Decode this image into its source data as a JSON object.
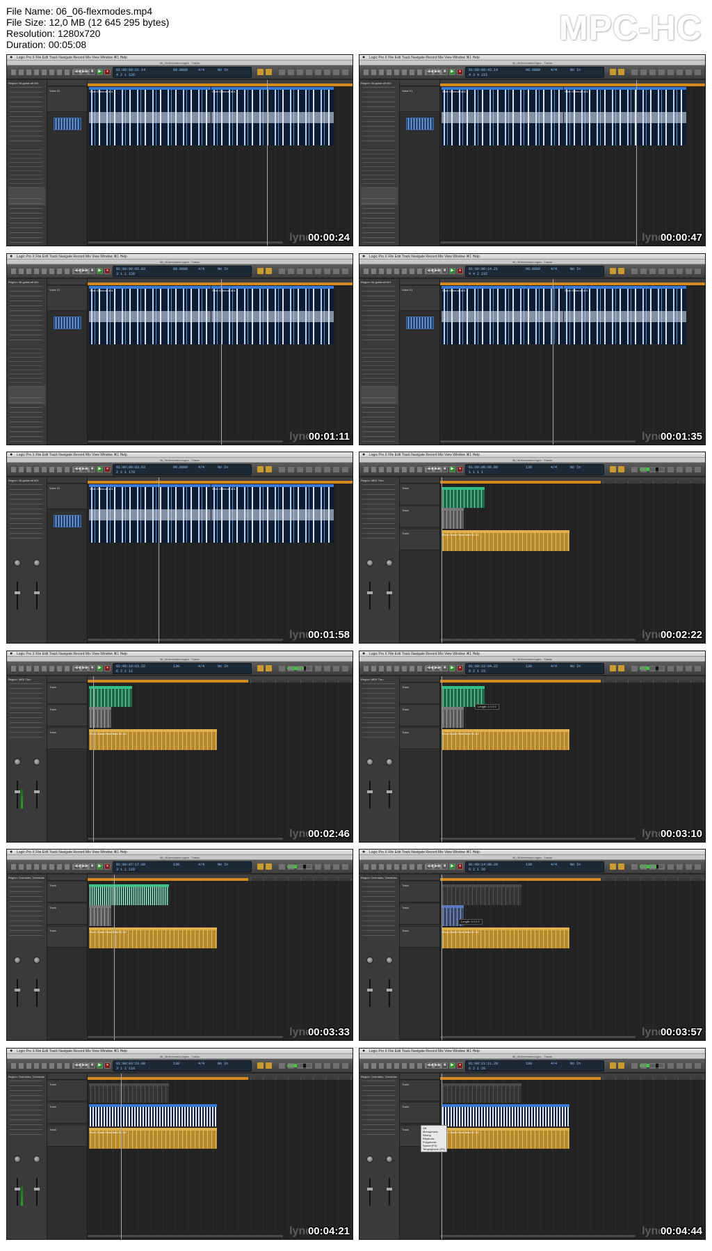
{
  "file_info": {
    "file_name": "File Name: 06_06-flexmodes.mp4",
    "file_size": "File Size: 12,0 MB (12 645 295 bytes)",
    "resolution": "Resolution: 1280x720",
    "duration": "Duration: 00:05:08"
  },
  "player_logo": "MPC-HC",
  "watermark": "lynd",
  "menu_items": "Logic Pro X   File   Edit   Track   Navigate   Record   Mix   View   Window   ⌘1   Help",
  "thumbnails": [
    {
      "timestamp": "00:00:24",
      "window_title": "06_06-flexmodes.logicx - Tracks",
      "lcd_top": "01:00:00:21.14",
      "lcd_bottom": "4  2  1  126",
      "tempo": "90.0000",
      "signature": "4/4",
      "key": "No In",
      "inspector_title": "Region: 06-guitar.aif #01",
      "track_name": "Voice 01",
      "region_label": "Slide Guitar.aif #01"
    },
    {
      "timestamp": "00:00:47",
      "window_title": "06_06-flexmodes.logicx - Tracks",
      "lcd_top": "01:00:00:42.14",
      "lcd_bottom": "4  3  4  215",
      "tempo": "90.0000",
      "signature": "4/4",
      "key": "No In",
      "inspector_title": "Region: 06-guitar.aif #01",
      "track_name": "Voice 01",
      "region_label": "Slide Guitar.aif #01"
    },
    {
      "timestamp": "00:01:11",
      "window_title": "06_06-flexmodes.logicx - Tracks",
      "lcd_top": "01:00:00:02.03",
      "lcd_bottom": "3  1  1  120",
      "tempo": "90.0000",
      "signature": "4/4",
      "key": "No In",
      "inspector_title": "Region: 06-guitar.aif #01",
      "track_name": "Voice 01",
      "region_label": "Slide Guitar.aif #01"
    },
    {
      "timestamp": "00:01:35",
      "window_title": "06_06-flexmodes.logicx - Tracks",
      "lcd_top": "01:00:00:14.21",
      "lcd_bottom": "4  4  2  215",
      "tempo": "90.0000",
      "signature": "4/4",
      "key": "No In",
      "inspector_title": "Region: 06-guitar.aif #01",
      "track_name": "Voice 01",
      "region_label": "Slide Guitar.aif #01"
    },
    {
      "timestamp": "00:01:58",
      "window_title": "06_06-flexmodes.logicx - Tracks",
      "lcd_top": "01:00:00:03.03",
      "lcd_bottom": "2  1  1  170",
      "tempo": "90.0000",
      "signature": "4/4",
      "key": "No In",
      "inspector_title": "Region: 06-guitar.aif #01",
      "track_name": "Voice 01",
      "region_label": "Slide Guitar.aif #01"
    },
    {
      "timestamp": "00:02:22",
      "window_title": "06_06-flexmodes.logicx - Tracks",
      "lcd_top": "01:00:00:00.00",
      "lcd_bottom": "1  1  1  1",
      "tempo": "130",
      "signature": "4/4",
      "key": "No In",
      "inspector_title": "Region: MIDI Thru",
      "track_name": "Track",
      "region_label": "Floor Guitar Rock Beat 02.1/2"
    },
    {
      "timestamp": "00:02:46",
      "window_title": "06_06-flexmodes.logicx - Tracks",
      "lcd_top": "01:00:10:03.22",
      "lcd_bottom": "6  2  1  11",
      "tempo": "130",
      "signature": "4/4",
      "key": "No In",
      "inspector_title": "Region: MIDI Thru",
      "track_name": "Track",
      "region_label": "Floor Guitar Rock Beat 02.1/2"
    },
    {
      "timestamp": "00:03:10",
      "window_title": "06_06-flexmodes.logicx - Tracks",
      "lcd_top": "01:00:22:04.22",
      "lcd_bottom": "6  2  1  23",
      "tempo": "130",
      "signature": "4/4",
      "key": "No In",
      "inspector_title": "Region: MIDI Thru",
      "track_name": "Track",
      "region_label": "Floor Guitar Rock Beat 02.1/2"
    },
    {
      "timestamp": "00:03:33",
      "window_title": "06_06-flexmodes.logicx - Tracks",
      "lcd_top": "01:00:07:17.00",
      "lcd_bottom": "3  1  1  110",
      "tempo": "130",
      "signature": "4/4",
      "key": "No In",
      "inspector_title": "Region: Overdubs, Overdubs",
      "track_name": "Track",
      "region_label": "Floor Guitar Rock Beat 02.1/2"
    },
    {
      "timestamp": "00:03:57",
      "window_title": "06_06-flexmodes.logicx - Tracks",
      "lcd_top": "01:00:14:00.20",
      "lcd_bottom": "6  2  1  20",
      "tempo": "130",
      "signature": "4/4",
      "key": "No In",
      "inspector_title": "Region: Overdubs, Overdubs",
      "track_name": "Track",
      "region_label": "Floor Guitar Rock Beat 02.1/2"
    },
    {
      "timestamp": "00:04:21",
      "window_title": "06_06-flexmodes.logicx - Tracks",
      "lcd_top": "01:00:03:23.00",
      "lcd_bottom": "3  1  1  110",
      "tempo": "130",
      "signature": "4/4",
      "key": "No In",
      "inspector_title": "Region: Overdubs, Overdubs",
      "track_name": "Track",
      "region_label": "Floor Guitar Rock Beat 02.1/2"
    },
    {
      "timestamp": "00:04:44",
      "window_title": "06_06-flexmodes.logicx - Tracks",
      "lcd_top": "01:00:21:11.20",
      "lcd_bottom": "6  2  1  20",
      "tempo": "130",
      "signature": "4/4",
      "key": "No In",
      "inspector_title": "Region: Overdubs, Overdubs",
      "track_name": "Track",
      "region_label": "Floor Guitar Rock Beat 02.1/2"
    }
  ],
  "flex_menu": {
    "items": [
      "Off",
      "Monophonic",
      "Slicing",
      "Rhythmic",
      "Polyphonic",
      "Speed (FX)",
      "Tempophone (FX)"
    ]
  },
  "tooltip_text": "Length: 4 4 0 0"
}
